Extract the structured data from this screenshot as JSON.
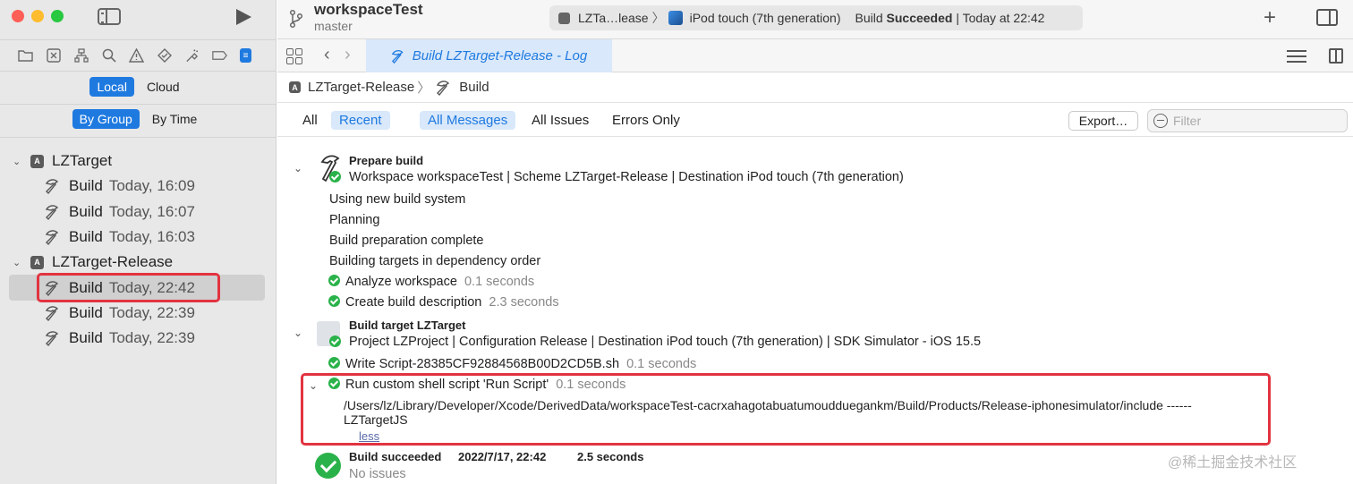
{
  "sidebar": {
    "seg_source": [
      "Local",
      "Cloud"
    ],
    "seg_grouping": [
      "By Group",
      "By Time"
    ],
    "groups": [
      {
        "name": "LZTarget",
        "items": [
          {
            "label": "Build",
            "date": "Today, 16:09"
          },
          {
            "label": "Build",
            "date": "Today, 16:07"
          },
          {
            "label": "Build",
            "date": "Today, 16:03"
          }
        ]
      },
      {
        "name": "LZTarget-Release",
        "items": [
          {
            "label": "Build",
            "date": "Today, 22:42"
          },
          {
            "label": "Build",
            "date": "Today, 22:39"
          },
          {
            "label": "Build",
            "date": "Today, 22:39"
          }
        ]
      }
    ]
  },
  "toolbar": {
    "project_title": "workspaceTest",
    "branch": "master",
    "activity_scheme": "LZTa…lease",
    "activity_device": "iPod touch (7th generation)",
    "activity_status_prefix": "Build",
    "activity_status_bold": "Succeeded",
    "activity_time": "| Today at 22:42",
    "plus": "+"
  },
  "tab": {
    "label": "Build LZTarget-Release - Log"
  },
  "breadcrumb": {
    "target": "LZTarget-Release",
    "action": "Build"
  },
  "filters": {
    "scope": [
      "All",
      "Recent"
    ],
    "messages": [
      "All Messages",
      "All Issues",
      "Errors Only"
    ],
    "export_label": "Export…",
    "filter_placeholder": "Filter"
  },
  "log": {
    "prepare_title": "Prepare build",
    "prepare_detail": "Workspace workspaceTest | Scheme LZTarget-Release | Destination iPod touch (7th generation)",
    "prepare_lines": [
      "Using new build system",
      "Planning",
      "Build preparation complete",
      "Building targets in dependency order"
    ],
    "prepare_steps": [
      {
        "label": "Analyze workspace",
        "time": "0.1 seconds"
      },
      {
        "label": "Create build description",
        "time": "2.3 seconds"
      }
    ],
    "target_title": "Build target LZTarget",
    "target_detail": "Project LZProject | Configuration Release | Destination iPod touch (7th generation) | SDK Simulator - iOS 15.5",
    "target_steps": [
      {
        "label": "Write Script-28385CF92884568B00D2CD5B.sh",
        "time": "0.1 seconds"
      },
      {
        "label": "Run custom shell script 'Run Script'",
        "time": "0.1 seconds"
      }
    ],
    "script_output_1": "/Users/lz/Library/Developer/Xcode/DerivedData/workspaceTest-cacrxahagotabuatumoudduegankm/Build/Products/Release-iphonesimulator/include ------",
    "script_output_2": "LZTargetJS",
    "less_label": "less",
    "result_title": "Build succeeded",
    "result_date": "2022/7/17, 22:42",
    "result_duration": "2.5 seconds",
    "result_issues": "No issues"
  },
  "watermark": "@稀土掘金技术社区",
  "colors": {
    "accent": "#1f7ae0",
    "success": "#2ab24a",
    "highlight": "#e23340"
  }
}
